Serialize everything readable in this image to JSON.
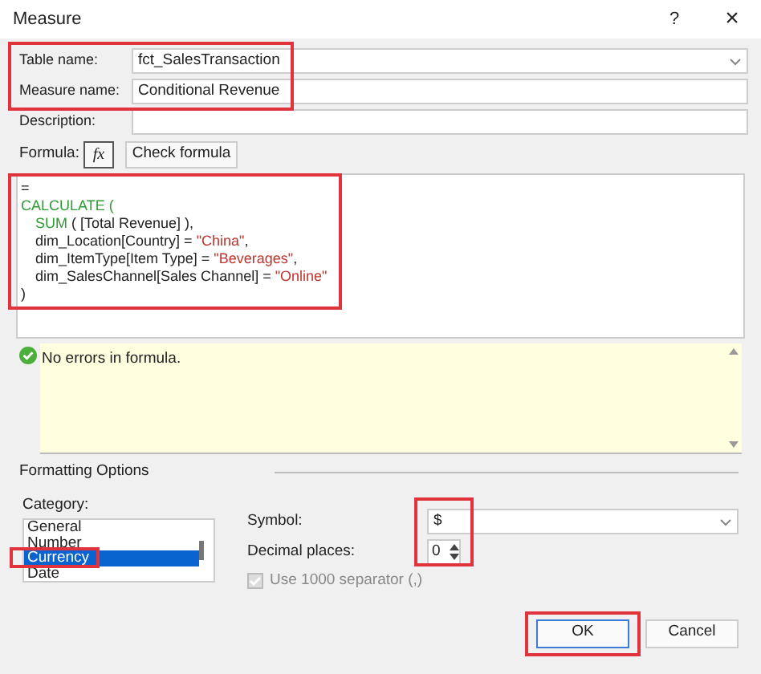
{
  "window": {
    "title": "Measure",
    "help": "?",
    "close": "×"
  },
  "fields": {
    "highlighted": true,
    "items": [
      {
        "label": "Table name:",
        "value": "fct_SalesTransaction",
        "kind": "combo"
      },
      {
        "label": "Measure name:",
        "value": "Conditional Revenue",
        "kind": "text"
      }
    ]
  },
  "description": {
    "label": "Description:"
  },
  "formula": {
    "label": "Formula:",
    "fx": "fx",
    "check_button": "Check formula",
    "highlighted": true,
    "lines": [
      {
        "indent": false,
        "tokens": [
          {
            "kind": "plain",
            "text": "="
          }
        ]
      },
      {
        "indent": false,
        "tokens": [
          {
            "kind": "func",
            "text": "CALCULATE ("
          }
        ]
      },
      {
        "indent": true,
        "tokens": [
          {
            "kind": "func",
            "text": "SUM"
          },
          {
            "kind": "plain",
            "text": " ( [Total Revenue] ),"
          }
        ]
      },
      {
        "indent": true,
        "tokens": [
          {
            "kind": "plain",
            "text": "dim_Location[Country] = "
          },
          {
            "kind": "string",
            "text": "\"China\""
          },
          {
            "kind": "plain",
            "text": ","
          }
        ]
      },
      {
        "indent": true,
        "tokens": [
          {
            "kind": "plain",
            "text": "dim_ItemType[Item Type] = "
          },
          {
            "kind": "string",
            "text": "\"Beverages\""
          },
          {
            "kind": "plain",
            "text": ","
          }
        ]
      },
      {
        "indent": true,
        "tokens": [
          {
            "kind": "plain",
            "text": "dim_SalesChannel[Sales Channel] = "
          },
          {
            "kind": "string",
            "text": "\"Online\""
          }
        ]
      },
      {
        "indent": false,
        "tokens": [
          {
            "kind": "plain",
            "text": ")"
          }
        ]
      }
    ]
  },
  "message": {
    "text": "No errors in formula."
  },
  "formatting": {
    "title": "Formatting Options",
    "category_label": "Category:",
    "categories": [
      {
        "label": "General",
        "selected": false
      },
      {
        "label": "Number",
        "selected": false
      },
      {
        "label": "Currency",
        "selected": true,
        "highlighted": true
      },
      {
        "label": "Date",
        "selected": false
      }
    ],
    "currency": {
      "highlighted": true,
      "symbol_label": "Symbol:",
      "symbol": "$",
      "decimal_label": "Decimal places:",
      "decimals": "0"
    },
    "separator": {
      "label": "Use 1000 separator (,)",
      "checked": true,
      "disabled": true
    }
  },
  "buttons": [
    {
      "label": "OK",
      "kind": "primary",
      "highlighted": true
    },
    {
      "label": "Cancel",
      "kind": "normal"
    }
  ]
}
